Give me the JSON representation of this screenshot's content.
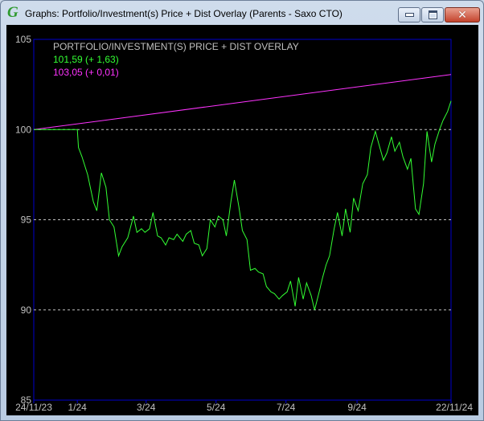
{
  "window": {
    "title": "Graphs: Portfolio/Investment(s) Price + Dist Overlay (Parents - Saxo CTO)",
    "icon": "green-g-icon",
    "buttons": {
      "minimize": "minimize-icon",
      "maximize": "maximize-icon",
      "close": "close-icon"
    }
  },
  "legend": {
    "heading": "PORTFOLIO/INVESTMENT(S) PRICE + DIST OVERLAY",
    "entries": [
      {
        "text": "101,59 (+ 1,63)",
        "color": "#33ff33"
      },
      {
        "text": "103,05 (+ 0,01)",
        "color": "#ff33ff"
      }
    ]
  },
  "colors": {
    "background": "#000000",
    "frame": "#0000cc",
    "grid": "#c0c0c0",
    "text": "#c0c0c0",
    "price": "#33ff33",
    "overlay": "#ff33ff"
  },
  "chart_data": {
    "type": "line",
    "ylim": [
      85,
      105
    ],
    "yticks": [
      85,
      90,
      95,
      100,
      105
    ],
    "grid_y": [
      90,
      95,
      100
    ],
    "xlim": [
      "2023-11-24",
      "2024-11-22"
    ],
    "xticks": [
      {
        "label": "24/11/23",
        "date": "2023-11-24"
      },
      {
        "label": "1/24",
        "date": "2024-01-01"
      },
      {
        "label": "3/24",
        "date": "2024-03-01"
      },
      {
        "label": "5/24",
        "date": "2024-05-01"
      },
      {
        "label": "7/24",
        "date": "2024-07-01"
      },
      {
        "label": "9/24",
        "date": "2024-09-01"
      },
      {
        "label": "22/11/24",
        "date": "2024-11-22"
      }
    ],
    "series": [
      {
        "color": "#33ff33",
        "x": [
          "2023-11-24",
          "2023-12-06",
          "2023-12-20",
          "2024-01-01",
          "2024-01-02",
          "2024-01-05",
          "2024-01-10",
          "2024-01-15",
          "2024-01-18",
          "2024-01-22",
          "2024-01-26",
          "2024-01-29",
          "2024-02-02",
          "2024-02-06",
          "2024-02-09",
          "2024-02-14",
          "2024-02-19",
          "2024-02-22",
          "2024-02-26",
          "2024-02-29",
          "2024-03-04",
          "2024-03-07",
          "2024-03-11",
          "2024-03-14",
          "2024-03-18",
          "2024-03-21",
          "2024-03-25",
          "2024-03-28",
          "2024-04-02",
          "2024-04-05",
          "2024-04-09",
          "2024-04-12",
          "2024-04-16",
          "2024-04-19",
          "2024-04-23",
          "2024-04-26",
          "2024-04-30",
          "2024-05-03",
          "2024-05-07",
          "2024-05-10",
          "2024-05-14",
          "2024-05-17",
          "2024-05-21",
          "2024-05-24",
          "2024-05-28",
          "2024-05-31",
          "2024-06-04",
          "2024-06-07",
          "2024-06-11",
          "2024-06-14",
          "2024-06-18",
          "2024-06-21",
          "2024-06-25",
          "2024-06-28",
          "2024-07-02",
          "2024-07-05",
          "2024-07-09",
          "2024-07-12",
          "2024-07-16",
          "2024-07-19",
          "2024-07-23",
          "2024-07-26",
          "2024-07-30",
          "2024-08-02",
          "2024-08-05",
          "2024-08-08",
          "2024-08-12",
          "2024-08-15",
          "2024-08-19",
          "2024-08-22",
          "2024-08-26",
          "2024-08-29",
          "2024-09-02",
          "2024-09-06",
          "2024-09-10",
          "2024-09-13",
          "2024-09-17",
          "2024-09-20",
          "2024-09-24",
          "2024-09-27",
          "2024-10-01",
          "2024-10-04",
          "2024-10-08",
          "2024-10-11",
          "2024-10-15",
          "2024-10-18",
          "2024-10-22",
          "2024-10-25",
          "2024-10-29",
          "2024-11-01",
          "2024-11-05",
          "2024-11-08",
          "2024-11-12",
          "2024-11-15",
          "2024-11-19",
          "2024-11-22"
        ],
        "values": [
          100.0,
          100.0,
          100.0,
          100.0,
          99.0,
          98.5,
          97.5,
          96.0,
          95.5,
          97.6,
          96.8,
          95.0,
          94.6,
          93.0,
          93.5,
          94.0,
          95.2,
          94.3,
          94.5,
          94.3,
          94.5,
          95.4,
          94.1,
          94.0,
          93.6,
          94.0,
          93.9,
          94.2,
          93.8,
          94.2,
          94.4,
          93.7,
          93.6,
          93.0,
          93.4,
          95.0,
          94.6,
          95.2,
          95.0,
          94.1,
          96.0,
          97.2,
          95.7,
          94.4,
          93.9,
          92.2,
          92.3,
          92.1,
          92.0,
          91.3,
          91.0,
          90.9,
          90.6,
          90.8,
          91.0,
          91.6,
          90.2,
          91.8,
          90.6,
          91.5,
          90.8,
          90.0,
          91.0,
          91.8,
          92.5,
          93.0,
          94.5,
          95.4,
          94.1,
          95.6,
          94.3,
          96.2,
          95.5,
          97.0,
          97.5,
          99.0,
          99.9,
          99.2,
          98.3,
          98.7,
          99.6,
          98.8,
          99.3,
          98.5,
          97.8,
          98.4,
          95.6,
          95.3,
          97.0,
          99.9,
          98.2,
          99.2,
          100.0,
          100.5,
          101.0,
          101.59
        ]
      },
      {
        "color": "#ff33ff",
        "x": [
          "2023-11-24",
          "2024-11-22"
        ],
        "values": [
          100.0,
          103.05
        ]
      }
    ]
  }
}
